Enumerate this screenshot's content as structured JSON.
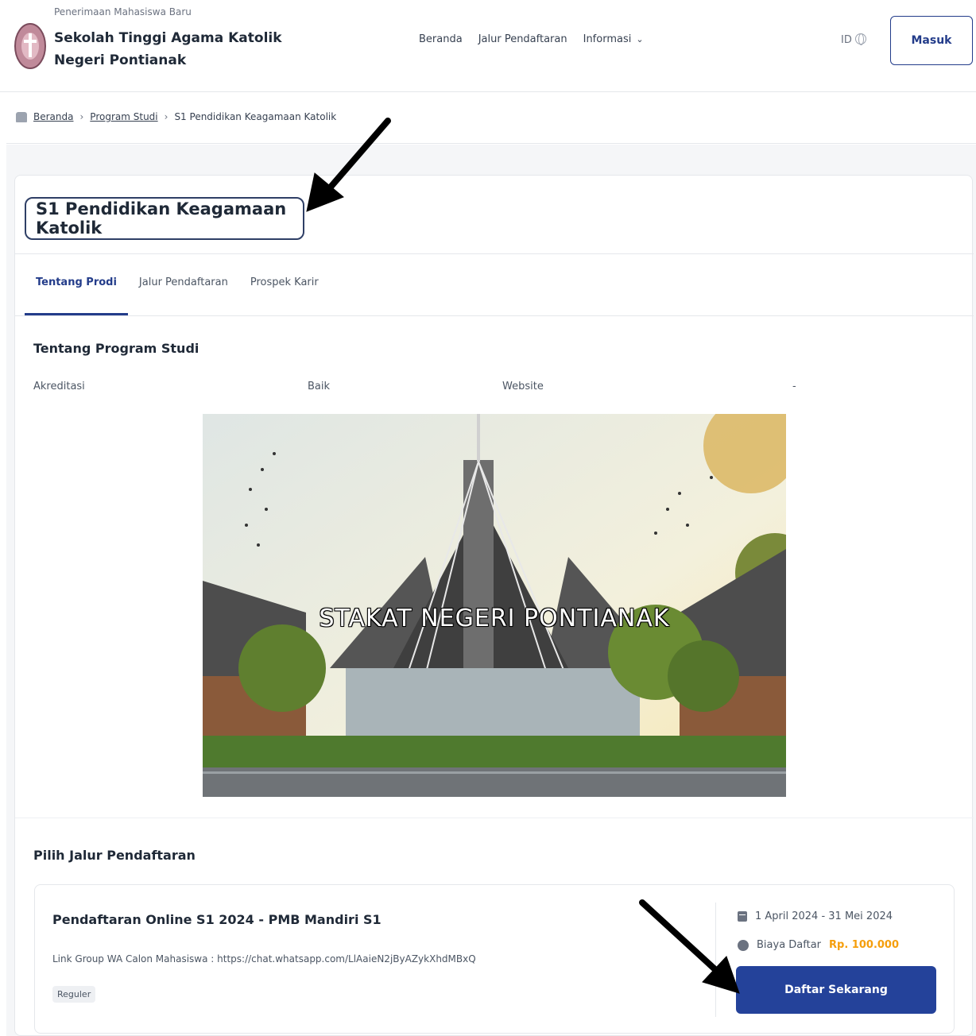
{
  "header": {
    "brand_small": "Penerimaan Mahasiswa Baru",
    "brand_title": "Sekolah Tinggi Agama Katolik Negeri Pontianak",
    "nav": [
      "Beranda",
      "Jalur Pendaftaran",
      "Informasi"
    ],
    "lang": "ID",
    "login_label": "Masuk"
  },
  "breadcrumb": {
    "items": [
      "Beranda",
      "Program Studi",
      "S1 Pendidikan Keagamaan Katolik"
    ]
  },
  "program": {
    "title": "S1 Pendidikan Keagamaan Katolik",
    "tabs": [
      "Tentang Prodi",
      "Jalur Pendaftaran",
      "Prospek Karir"
    ],
    "section_title": "Tentang Program Studi",
    "akreditasi_label": "Akreditasi",
    "akreditasi_value": "Baik",
    "website_label": "Website",
    "website_value": "-",
    "image_caption": "STAKAT NEGERI PONTIANAK"
  },
  "registration": {
    "section_title": "Pilih Jalur Pendaftaran",
    "path_title": "Pendaftaran Online S1 2024 - PMB Mandiri S1",
    "path_link": "Link Group WA Calon Mahasiswa : https://chat.whatsapp.com/LlAaieN2jByAZykXhdMBxQ",
    "badge": "Reguler",
    "date_range": "1 April 2024 - 31 Mei 2024",
    "fee_label": "Biaya Daftar",
    "fee_amount": "Rp. 100.000",
    "register_button": "Daftar Sekarang"
  },
  "colors": {
    "primary": "#24429a",
    "accent_fee": "#f59e0b",
    "title_border": "#2f3f66"
  },
  "icons": [
    "logo-emblem-icon",
    "chevron-down-icon",
    "globe-icon",
    "home-icon",
    "calendar-icon",
    "coin-icon"
  ]
}
